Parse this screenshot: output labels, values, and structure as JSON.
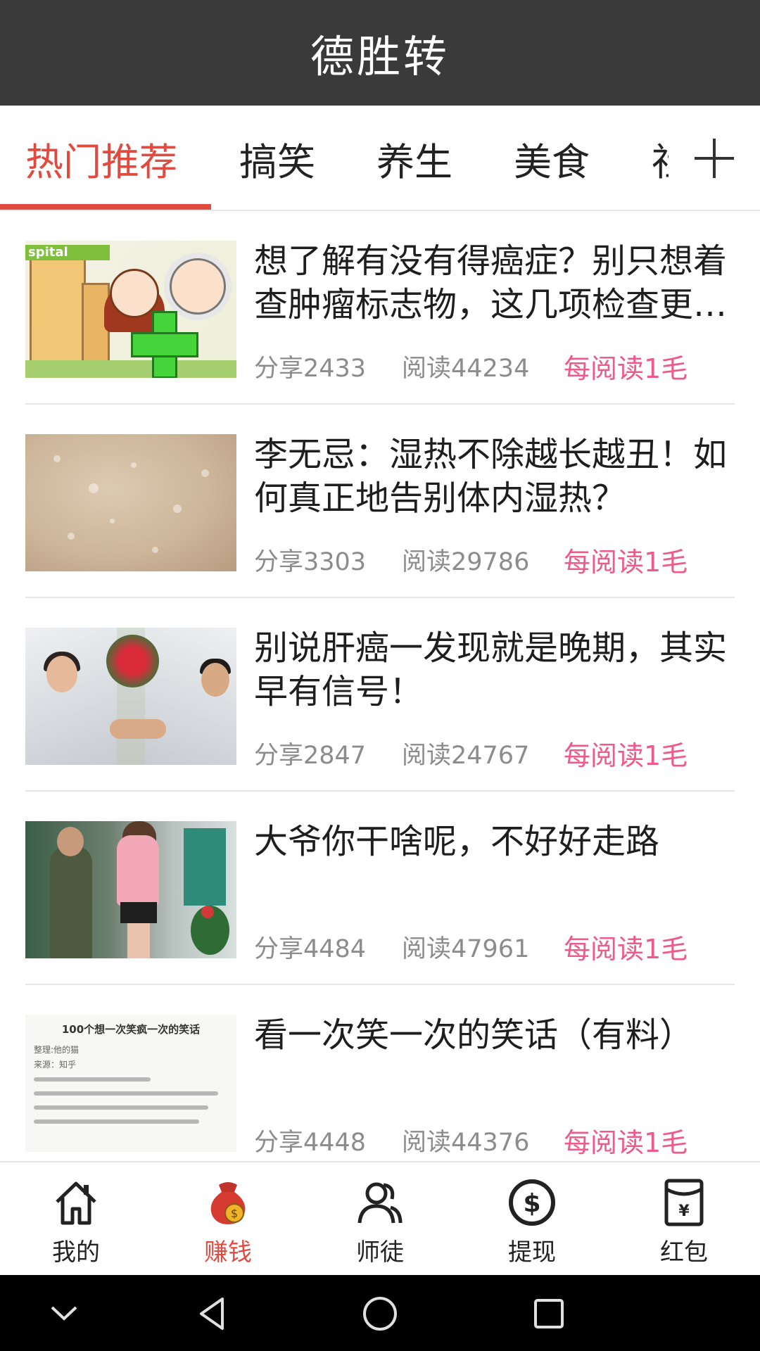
{
  "header": {
    "title": "德胜转"
  },
  "tabs": {
    "items": [
      {
        "label": "热门推荐",
        "active": true
      },
      {
        "label": "搞笑",
        "active": false
      },
      {
        "label": "养生",
        "active": false
      },
      {
        "label": "美食",
        "active": false
      },
      {
        "label": "社",
        "active": false
      }
    ],
    "more_icon": "plus-icon"
  },
  "feed": {
    "items": [
      {
        "title": "想了解有没有得癌症？别只想着查肿瘤标志物，这几项检查更重要",
        "share": "分享2433",
        "read": "阅读44234",
        "reward": "每阅读1毛"
      },
      {
        "title": "李无忌：湿热不除越长越丑！如何真正地告别体内湿热？",
        "share": "分享3303",
        "read": "阅读29786",
        "reward": "每阅读1毛"
      },
      {
        "title": "别说肝癌一发现就是晚期，其实早有信号！",
        "share": "分享2847",
        "read": "阅读24767",
        "reward": "每阅读1毛"
      },
      {
        "title": "大爷你干啥呢，不好好走路",
        "share": "分享4484",
        "read": "阅读47961",
        "reward": "每阅读1毛"
      },
      {
        "title": "看一次笑一次的笑话（有料）",
        "share": "分享4448",
        "read": "阅读44376",
        "reward": "每阅读1毛"
      }
    ],
    "thumb5": {
      "heading": "100个想一次笑疯一次的笑话",
      "line1": "整理:他的猫",
      "line2": "来源：知乎"
    },
    "thumb1_sign": "spital"
  },
  "bottom_nav": {
    "items": [
      {
        "label": "我的",
        "icon": "home-icon",
        "active": false
      },
      {
        "label": "赚钱",
        "icon": "money-bag-icon",
        "active": true
      },
      {
        "label": "师徒",
        "icon": "people-icon",
        "active": false
      },
      {
        "label": "提现",
        "icon": "dollar-coin-icon",
        "active": false
      },
      {
        "label": "红包",
        "icon": "yuan-envelope-icon",
        "active": false
      }
    ]
  },
  "colors": {
    "header_bg": "#3a3a3a",
    "accent": "#e04a3f",
    "reward": "#ee5a8a"
  }
}
